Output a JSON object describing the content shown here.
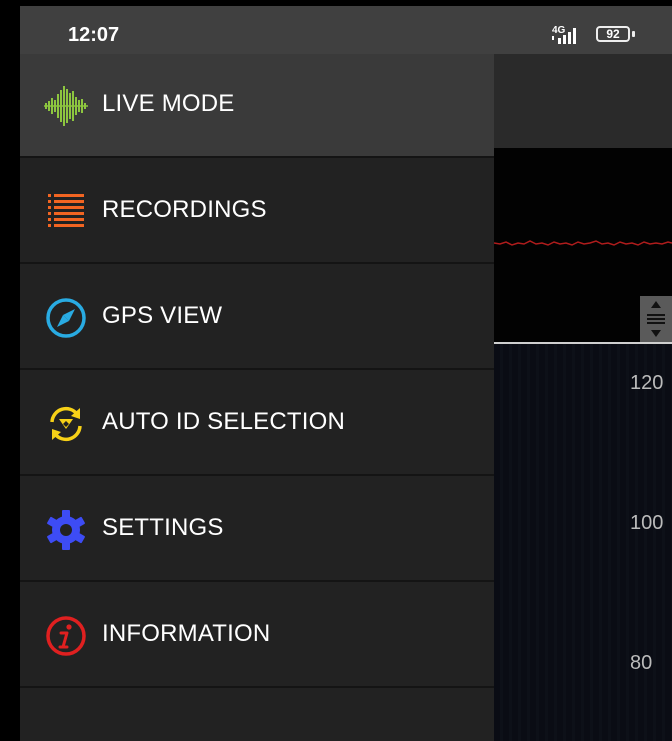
{
  "status_bar": {
    "time": "12:07",
    "network": "4G",
    "battery": "92"
  },
  "menu": {
    "items": [
      {
        "label": "LIVE MODE",
        "icon": "sound-wave-icon",
        "color": "#8dc63f",
        "active": true
      },
      {
        "label": "RECORDINGS",
        "icon": "list-icon",
        "color": "#f26522"
      },
      {
        "label": "GPS VIEW",
        "icon": "compass-icon",
        "color": "#29abe2"
      },
      {
        "label": "AUTO ID SELECTION",
        "icon": "cycle-arrows-icon",
        "color": "#f7d117"
      },
      {
        "label": "SETTINGS",
        "icon": "gear-icon",
        "color": "#3d4cf5"
      },
      {
        "label": "INFORMATION",
        "icon": "info-icon",
        "color": "#e02020"
      }
    ]
  },
  "spectrogram": {
    "y_ticks": [
      "120",
      "100",
      "80"
    ]
  }
}
